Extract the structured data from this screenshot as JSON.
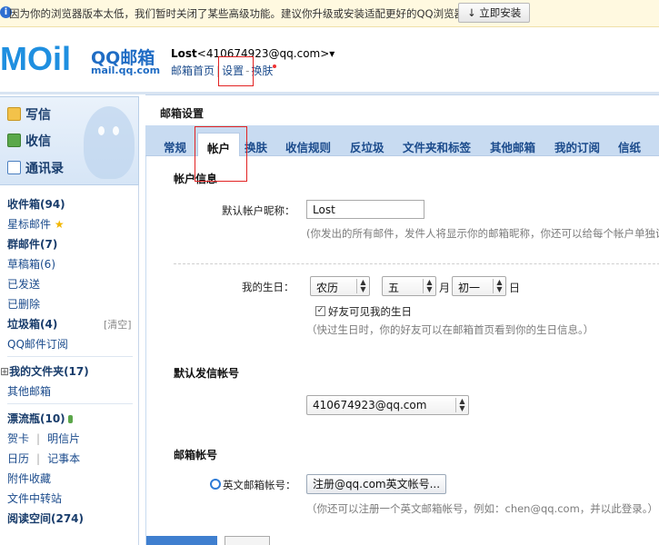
{
  "warning": {
    "icon": "info-icon",
    "text": "因为你的浏览器版本太低，我们暂时关闭了某些高级功能。建议你升级或安装适配更好的QQ浏览器。",
    "install_button": "↓ 立即安装"
  },
  "header": {
    "logo_text": "MOil",
    "logo_brand": "QQ邮箱",
    "logo_domain": "mail.qq.com",
    "user_name": "Lost",
    "user_email": "<410674923@qq.com>",
    "user_caret": "▾",
    "nav": {
      "home": "邮箱首页",
      "settings": "设置",
      "skin": "换肤"
    }
  },
  "sidebar": {
    "actions": {
      "compose": "写信",
      "inbox": "收信",
      "contacts": "通讯录"
    },
    "items": {
      "inbox": "收件箱(94)",
      "starred": "星标邮件",
      "group": "群邮件(7)",
      "drafts": "草稿箱(6)",
      "sent": "已发送",
      "deleted": "已删除",
      "spam": "垃圾箱(4)",
      "spam_clear": "[清空]",
      "subscriptions": "QQ邮件订阅",
      "my_folders": "我的文件夹(17)",
      "other_mail": "其他邮箱",
      "drift_bottle": "漂流瓶(10)",
      "cards": "贺卡",
      "postcards": "明信片",
      "calendar": "日历",
      "notes": "记事本",
      "attachments": "附件收藏",
      "transfer": "文件中转站",
      "reading": "阅读空间(274)"
    }
  },
  "main": {
    "title": "邮箱设置",
    "tabs": [
      "常规",
      "帐户",
      "换肤",
      "收信规则",
      "反垃圾",
      "文件夹和标签",
      "其他邮箱",
      "我的订阅",
      "信纸"
    ],
    "active_tab": "帐户",
    "account_info": {
      "heading": "帐户信息",
      "nickname_label": "默认帐户昵称：",
      "nickname_value": "Lost",
      "nickname_hint": "(你发出的所有邮件，发件人将显示你的邮箱昵称，你还可以给每个帐户单独设置",
      "birthday_label": "我的生日：",
      "calendar_type": "农历",
      "month": "五",
      "month_unit": "月",
      "day": "初一",
      "day_unit": "日",
      "birthday_visible_label": "好友可见我的生日",
      "birthday_visible_checked": true,
      "birthday_hint": "（快过生日时，你的好友可以在邮箱首页看到你的生日信息。）"
    },
    "default_sender": {
      "heading": "默认发信帐号",
      "value": "410674923@qq.com"
    },
    "mail_account": {
      "heading": "邮箱帐号",
      "english_label": "英文邮箱帐号：",
      "register_button": "注册@qq.com英文帐号...",
      "english_hint": "（你还可以注册一个英文邮箱帐号，例如：chen@qq.com，并以此登录。）"
    }
  },
  "colors": {
    "accent": "#1f6cc4",
    "link": "#1b4b8c",
    "tabbar": "#c8dbf1",
    "highlight_box": "#e22222"
  }
}
